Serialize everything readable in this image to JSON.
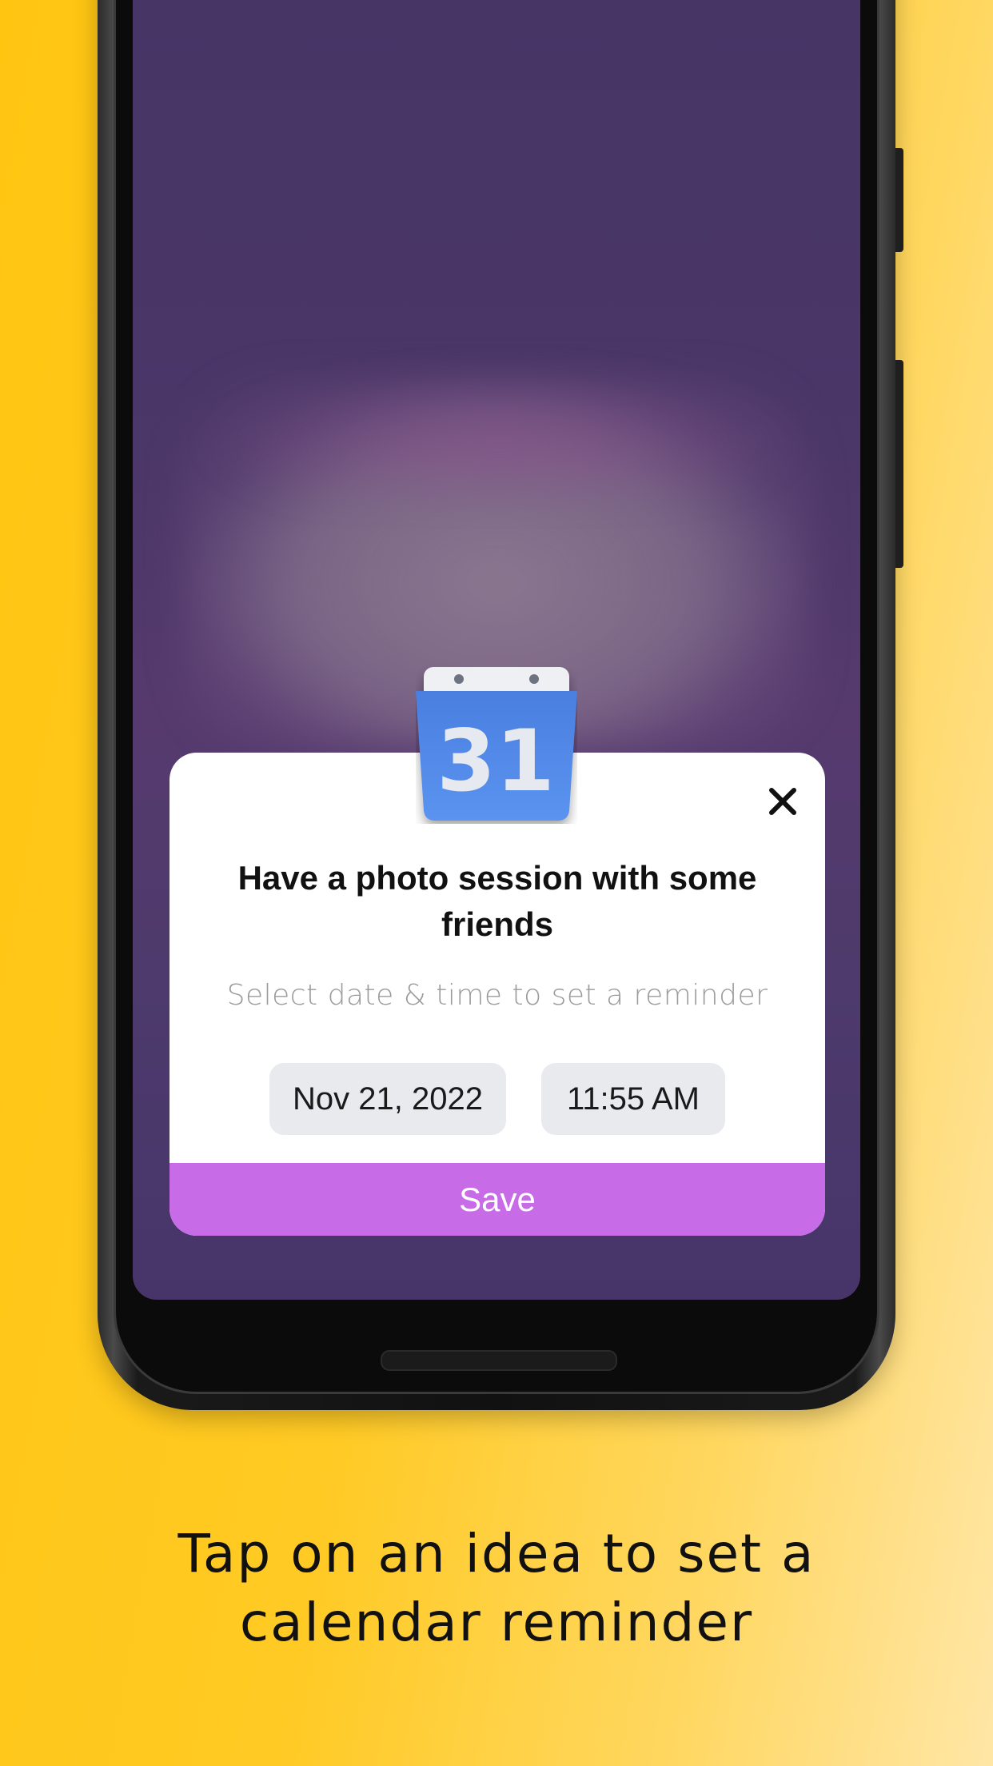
{
  "dialog": {
    "title": "Have a photo session with some friends",
    "subtitle": "Select date & time to set a reminder",
    "date_value": "Nov 21, 2022",
    "time_value": "11:55 AM",
    "save_label": "Save",
    "close_icon": "close-icon",
    "app_icon": {
      "name": "calendar-icon",
      "day_number": "31"
    }
  },
  "caption": "Tap on an idea to set a calendar reminder",
  "colors": {
    "background_yellow": "#ffc511",
    "screen_purple": "#463565",
    "save_button": "#c76ce6",
    "chip_gray": "#e8eaed",
    "calendar_blue": "#4285f4"
  }
}
